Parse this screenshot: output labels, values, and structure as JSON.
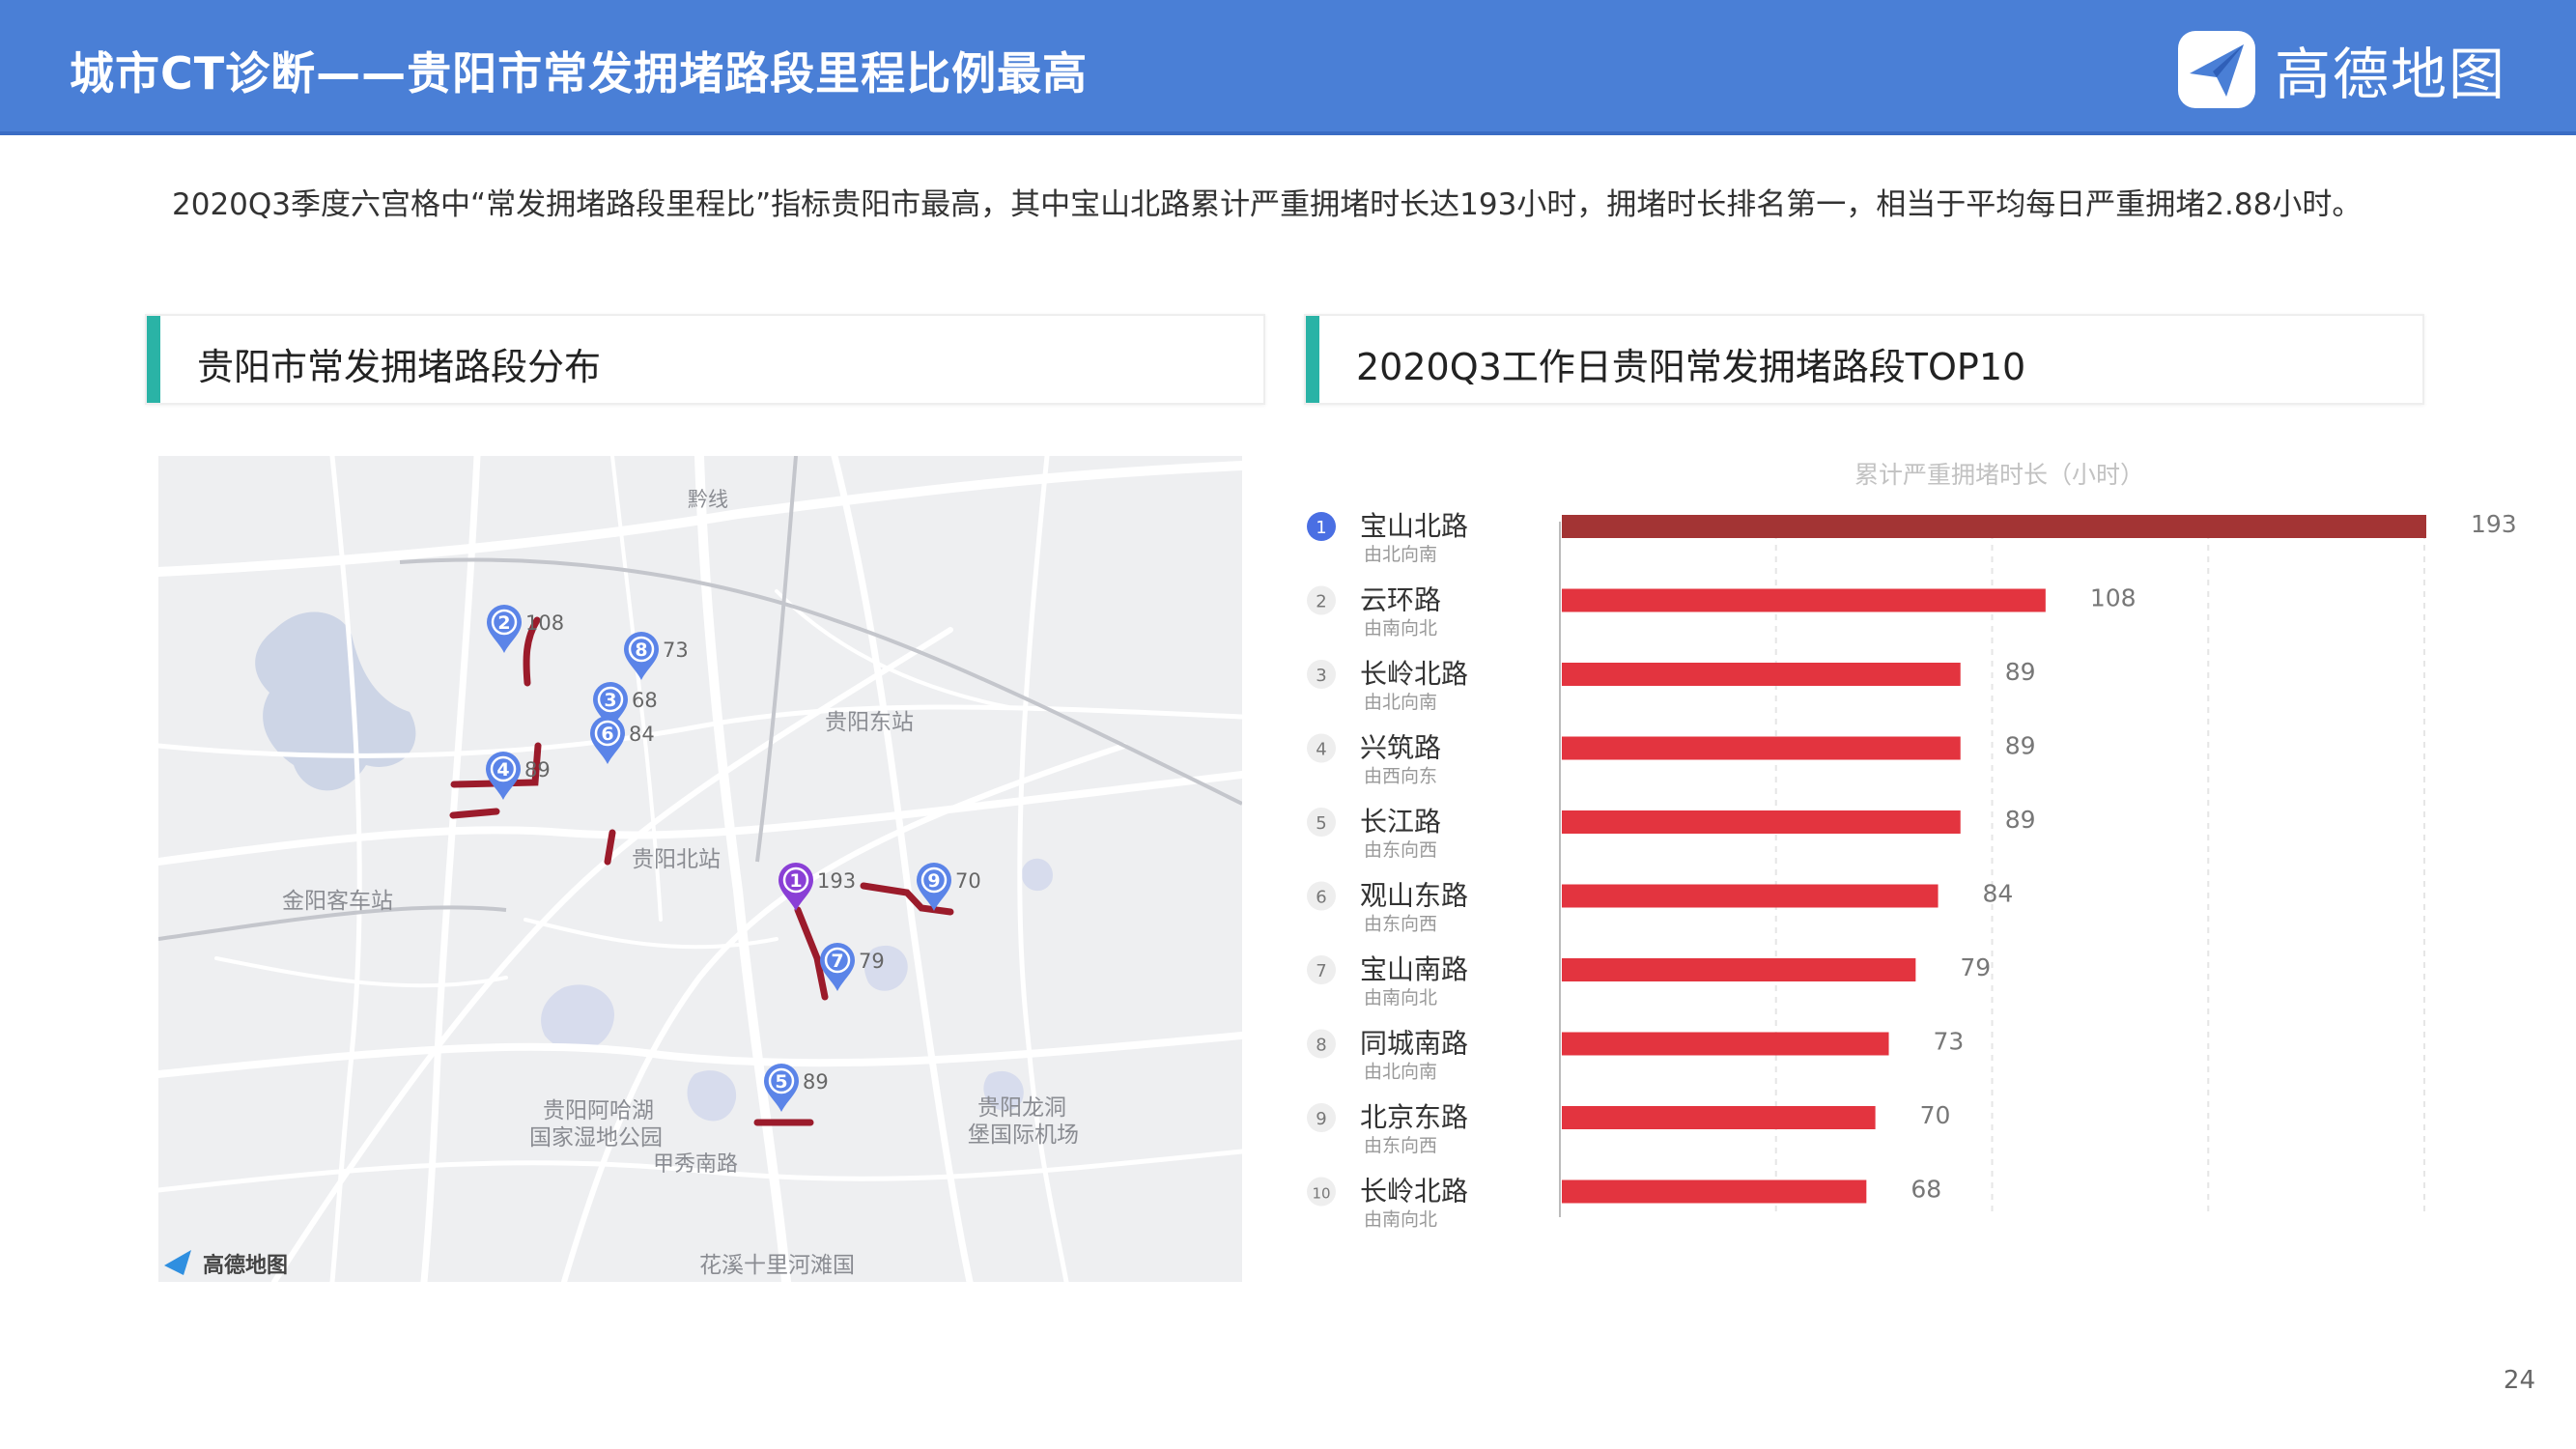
{
  "header": {
    "title": "城市CT诊断——贵阳市常发拥堵路段里程比例最高",
    "brand_name": "高德地图",
    "bg_color": "#4a7fd6"
  },
  "summary": "2020Q3季度六宫格中“常发拥堵路段里程比”指标贵阳市最高，其中宝山北路累计严重拥堵时长达193小时，拥堵时长排名第一，相当于平均每日严重拥堵2.88小时。",
  "left_section": {
    "title": "贵阳市常发拥堵路段分布"
  },
  "right_section": {
    "title": "2020Q3工作日贵阳常发拥堵路段TOP10"
  },
  "map": {
    "labels": {
      "guiyang_east": "贵阳东站",
      "guiyang_north": "贵阳北站",
      "jinyang_bus": "金阳客车站",
      "ahahu_1": "贵阳阿哈湖",
      "ahahu_2": "国家湿地公园",
      "airport_1": "贵阳龙洞",
      "airport_2": "堡国际机场",
      "jiaxiu_road": "甲秀南路",
      "rail_line": "黔线",
      "bottom_cut": "花溪十里河滩国"
    },
    "watermark": "高德地图",
    "markers": [
      {
        "rank": "1",
        "value": "193"
      },
      {
        "rank": "2",
        "value": "108"
      },
      {
        "rank": "3",
        "value": "68"
      },
      {
        "rank": "4",
        "value": "89"
      },
      {
        "rank": "5",
        "value": "89"
      },
      {
        "rank": "6",
        "value": "84"
      },
      {
        "rank": "7",
        "value": "79"
      },
      {
        "rank": "8",
        "value": "73"
      },
      {
        "rank": "9",
        "value": "70"
      }
    ],
    "colors": {
      "pin": "#5b84e8",
      "pin_top": "#8a3fd6",
      "road": "#9b1b2b"
    }
  },
  "chart_data": {
    "type": "bar",
    "orientation": "horizontal",
    "title": "累计严重拥堵时长（小时）",
    "categories": [
      "宝山北路",
      "云环路",
      "长岭北路",
      "兴筑路",
      "长江路",
      "观山东路",
      "宝山南路",
      "同城南路",
      "北京东路",
      "长岭北路"
    ],
    "directions": [
      "由北向南",
      "由南向北",
      "由北向南",
      "由西向东",
      "由东向西",
      "由东向西",
      "由南向北",
      "由北向南",
      "由东向西",
      "由南向北"
    ],
    "ranks": [
      "1",
      "2",
      "3",
      "4",
      "5",
      "6",
      "7",
      "8",
      "9",
      "10"
    ],
    "values": [
      193,
      108,
      89,
      89,
      89,
      84,
      79,
      73,
      70,
      68
    ],
    "value_labels": [
      "193",
      "108",
      "89",
      "89",
      "89",
      "84",
      "79",
      "73",
      "70",
      "68"
    ],
    "xlim": [
      0,
      193
    ],
    "colors": {
      "top": "#a33434",
      "default": "#e3343f",
      "rank1_badge": "#4a6fe3"
    }
  },
  "page_number": "24"
}
